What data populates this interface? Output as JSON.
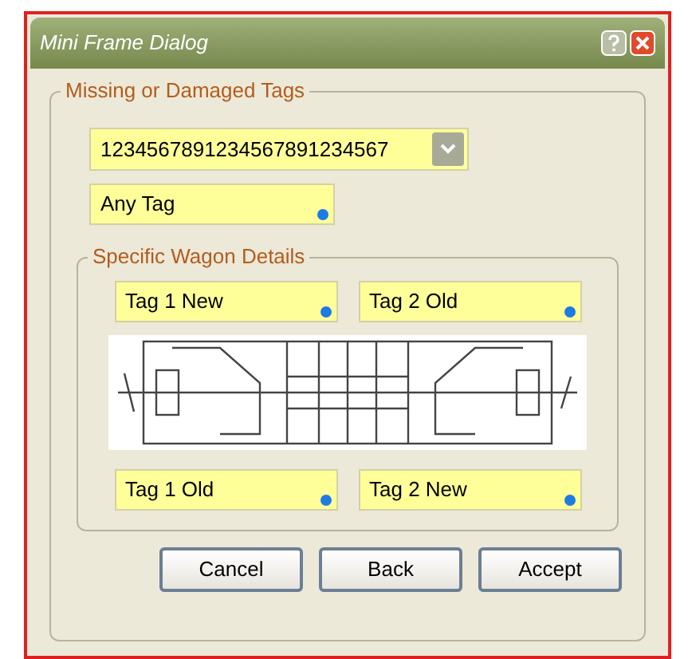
{
  "window": {
    "title": "Mini Frame Dialog"
  },
  "group": {
    "title": "Missing or Damaged Tags",
    "combo": {
      "value": "1234567891234567891234567"
    },
    "any_tag": {
      "value": "Any Tag"
    },
    "wagon": {
      "title": "Specific Wagon Details",
      "top_tags": [
        {
          "value": "Tag 1 New"
        },
        {
          "value": "Tag 2 Old"
        }
      ],
      "bottom_tags": [
        {
          "value": "Tag 1 Old"
        },
        {
          "value": "Tag 2 New"
        }
      ]
    }
  },
  "buttons": [
    {
      "label": "Cancel"
    },
    {
      "label": "Back"
    },
    {
      "label": "Accept"
    }
  ]
}
